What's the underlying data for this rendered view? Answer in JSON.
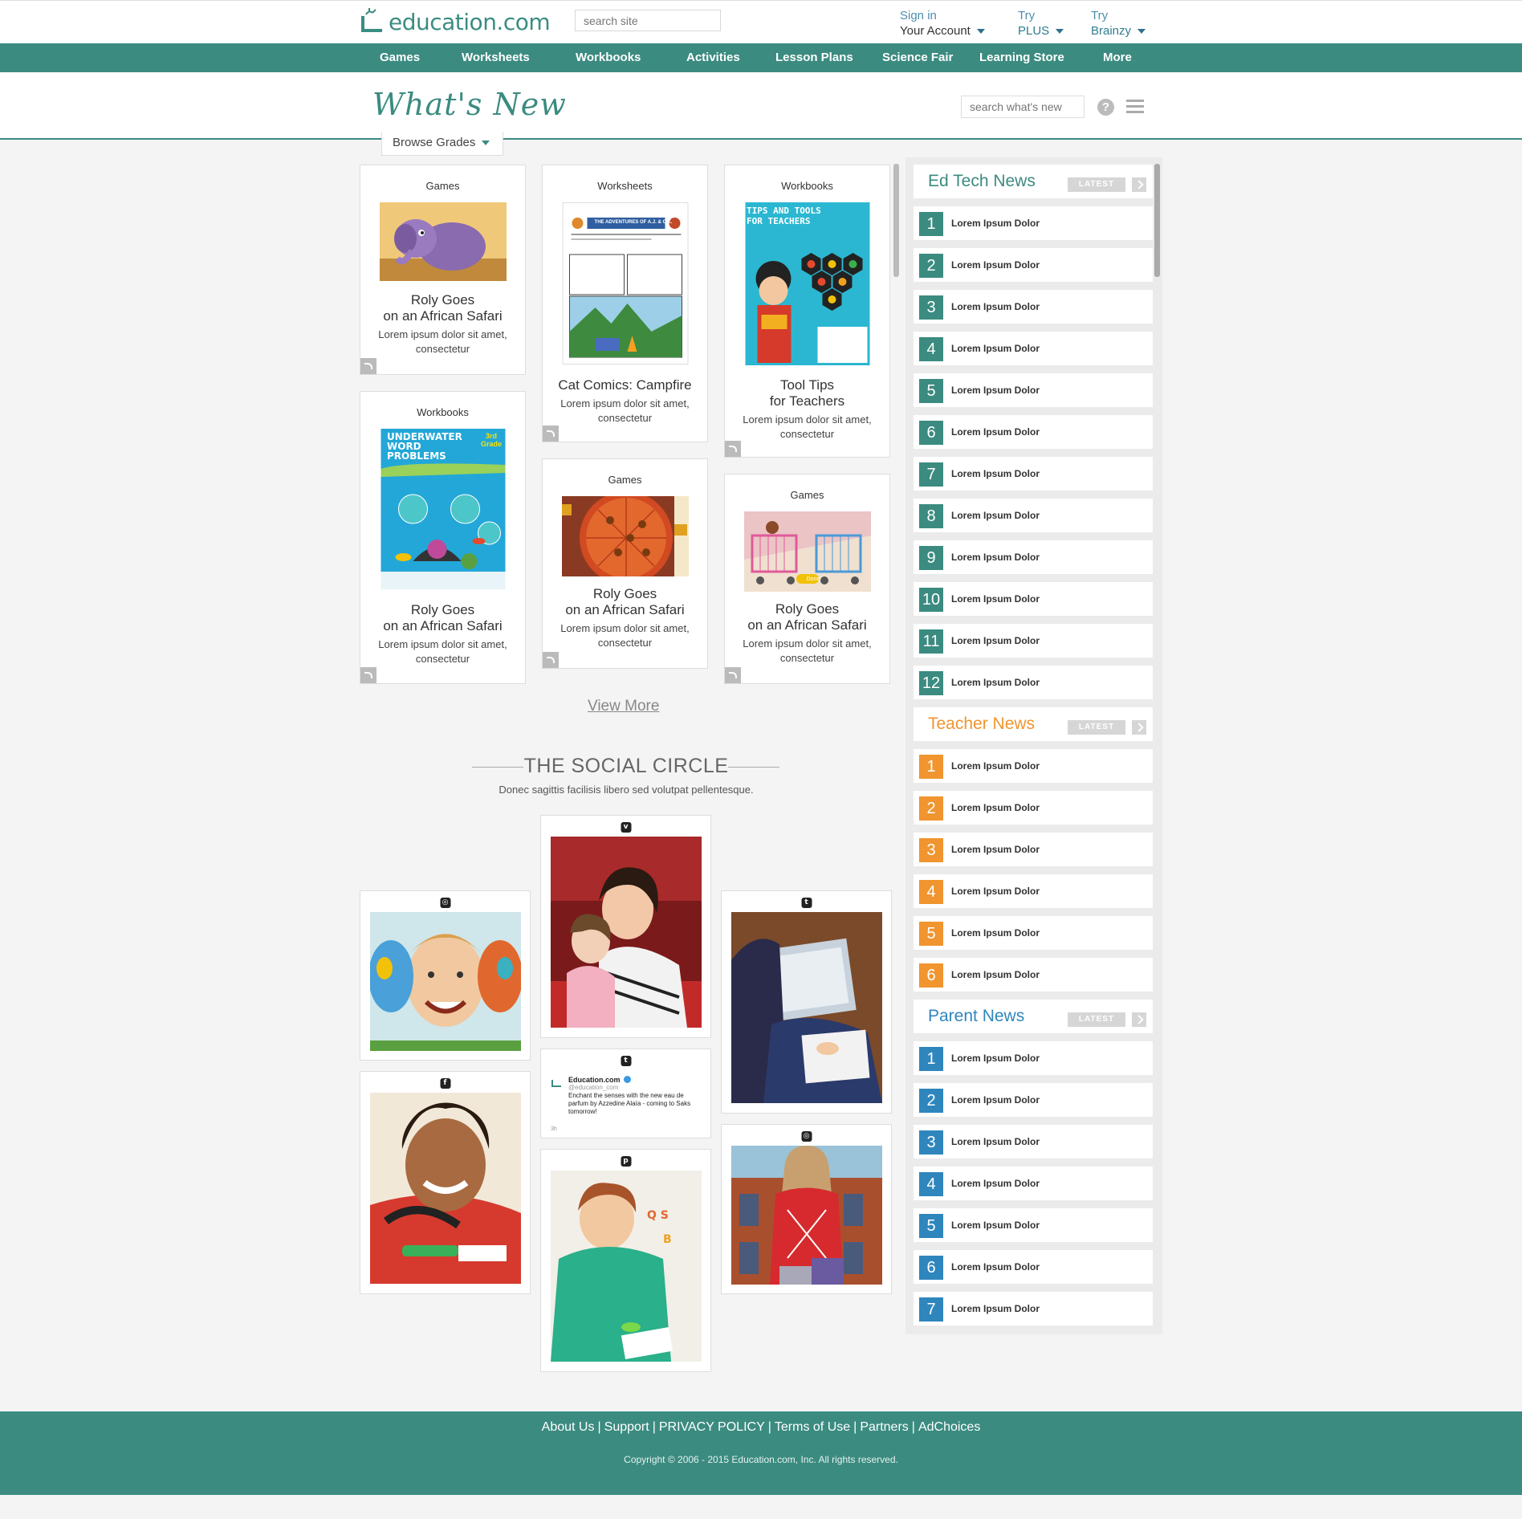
{
  "header": {
    "logo_text": "education.com",
    "search_placeholder": "search site",
    "sign_in_line1": "Sign in",
    "sign_in_line2": "Your Account",
    "try_plus_line1": "Try",
    "try_plus_line2": "PLUS",
    "try_brainzy_line1": "Try",
    "try_brainzy_line2": "Brainzy"
  },
  "nav": [
    "Games",
    "Worksheets",
    "Workbooks",
    "Activities",
    "Lesson Plans",
    "Science Fair",
    "Learning Store",
    "More"
  ],
  "whats_new": {
    "title": "What's New",
    "search_placeholder": "search what's new",
    "browse_label": "Browse Grades"
  },
  "cards": [
    {
      "category": "Games",
      "title": "Roly Goes on an African Safari",
      "desc": "Lorem ipsum dolor sit amet, consectetur"
    },
    {
      "category": "Worksheets",
      "title": "Cat Comics: Campfire",
      "desc": "Lorem ipsum dolor sit amet, consectetur",
      "image_text": "THE ADVENTURES OF A.J. & C.K."
    },
    {
      "category": "Workbooks",
      "title": "Tool Tips for Teachers",
      "desc": "Lorem ipsum dolor sit amet, consectetur",
      "image_text": "TIPS AND TOOLS FOR TEACHERS"
    },
    {
      "category": "Workbooks",
      "title": "Roly Goes on an African Safari",
      "desc": "Lorem ipsum dolor sit amet, consectetur",
      "image_text": "UNDERWATER WORD PROBLEMS",
      "image_badge": "3rd Grade"
    },
    {
      "category": "Games",
      "title": "Roly Goes on an African Safari",
      "desc": "Lorem ipsum dolor sit amet, consectetur"
    },
    {
      "category": "Games",
      "title": "Roly Goes on an African Safari",
      "desc": "Lorem ipsum dolor sit amet, consectetur",
      "image_badge": "Done"
    }
  ],
  "view_more": "View More",
  "social": {
    "title": "THE SOCIAL CIRCLE",
    "subtitle": "Donec sagittis facilisis libero sed volutpat pellentesque.",
    "tweet": {
      "name": "Education.com",
      "handle": "@education_com",
      "text": "Enchant the senses with the new eau de parfum by Azzedine Alaïa - coming to Saks tomorrow!",
      "time": "3h"
    },
    "icons": [
      "instagram-icon",
      "vine-icon",
      "tumblr-icon",
      "facebook-icon",
      "twitter-icon",
      "pinterest-icon",
      "instagram-icon"
    ]
  },
  "sidebar": {
    "ed_tech": {
      "title": "Ed Tech News",
      "latest": "LATEST",
      "color": "#3b8b80",
      "items": [
        "1",
        "2",
        "3",
        "4",
        "5",
        "6",
        "7",
        "8",
        "9",
        "10",
        "11",
        "12"
      ]
    },
    "teacher": {
      "title": "Teacher News",
      "latest": "LATEST",
      "color": "#f0952f",
      "items": [
        "1",
        "2",
        "3",
        "4",
        "5",
        "6"
      ]
    },
    "parent": {
      "title": "Parent News",
      "latest": "LATEST",
      "color": "#2f86bd",
      "items": [
        "1",
        "2",
        "3",
        "4",
        "5",
        "6",
        "7"
      ]
    },
    "item_text": "Lorem Ipsum Dolor"
  },
  "footer": {
    "links": [
      "About Us",
      "Support",
      "PRIVACY POLICY",
      "Terms of Use",
      "Partners",
      "AdChoices"
    ],
    "copyright": "Copyright © 2006 - 2015 Education.com, Inc. All rights reserved."
  },
  "colors": {
    "brand": "#3b8b80",
    "teacher": "#f0952f",
    "parent": "#2f86bd"
  }
}
